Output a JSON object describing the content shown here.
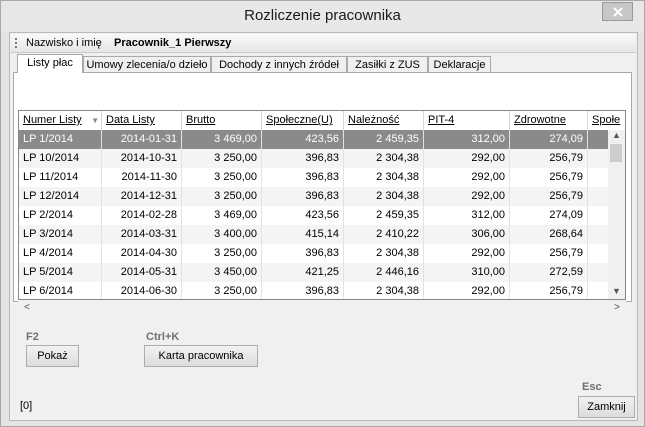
{
  "window": {
    "title": "Rozliczenie pracownika"
  },
  "employee": {
    "label": "Nazwisko i imię",
    "value": "Pracownik_1 Pierwszy"
  },
  "tabs": [
    {
      "label": "Listy płac",
      "active": true
    },
    {
      "label": "Umowy zlecenia/o dzieło",
      "active": false
    },
    {
      "label": "Dochody z innych źródeł",
      "active": false
    },
    {
      "label": "Zasiłki z ZUS",
      "active": false
    },
    {
      "label": "Deklaracje",
      "active": false
    }
  ],
  "table": {
    "columns": [
      "Numer Listy",
      "Data Listy",
      "Brutto",
      "Społeczne(U)",
      "Należność",
      "PIT-4",
      "Zdrowotne",
      "Społe"
    ],
    "rows": [
      [
        "LP 1/2014",
        "2014-01-31",
        "3 469,00",
        "423,56",
        "2 459,35",
        "312,00",
        "274,09",
        ""
      ],
      [
        "LP 10/2014",
        "2014-10-31",
        "3 250,00",
        "396,83",
        "2 304,38",
        "292,00",
        "256,79",
        ""
      ],
      [
        "LP 11/2014",
        "2014-11-30",
        "3 250,00",
        "396,83",
        "2 304,38",
        "292,00",
        "256,79",
        ""
      ],
      [
        "LP 12/2014",
        "2014-12-31",
        "3 250,00",
        "396,83",
        "2 304,38",
        "292,00",
        "256,79",
        ""
      ],
      [
        "LP 2/2014",
        "2014-02-28",
        "3 469,00",
        "423,56",
        "2 459,35",
        "312,00",
        "274,09",
        ""
      ],
      [
        "LP 3/2014",
        "2014-03-31",
        "3 400,00",
        "415,14",
        "2 410,22",
        "306,00",
        "268,64",
        ""
      ],
      [
        "LP 4/2014",
        "2014-04-30",
        "3 250,00",
        "396,83",
        "2 304,38",
        "292,00",
        "256,79",
        ""
      ],
      [
        "LP 5/2014",
        "2014-05-31",
        "3 450,00",
        "421,25",
        "2 446,16",
        "310,00",
        "272,59",
        ""
      ],
      [
        "LP 6/2014",
        "2014-06-30",
        "3 250,00",
        "396,83",
        "2 304,38",
        "292,00",
        "256,79",
        ""
      ]
    ],
    "selected_row": 0
  },
  "actions": {
    "show_key": "F2",
    "show_label": "Pokaż",
    "card_key": "Ctrl+K",
    "card_label": "Karta pracownika",
    "close_key": "Esc",
    "close_label": "Zamknij"
  },
  "status": {
    "count": "[0]"
  }
}
